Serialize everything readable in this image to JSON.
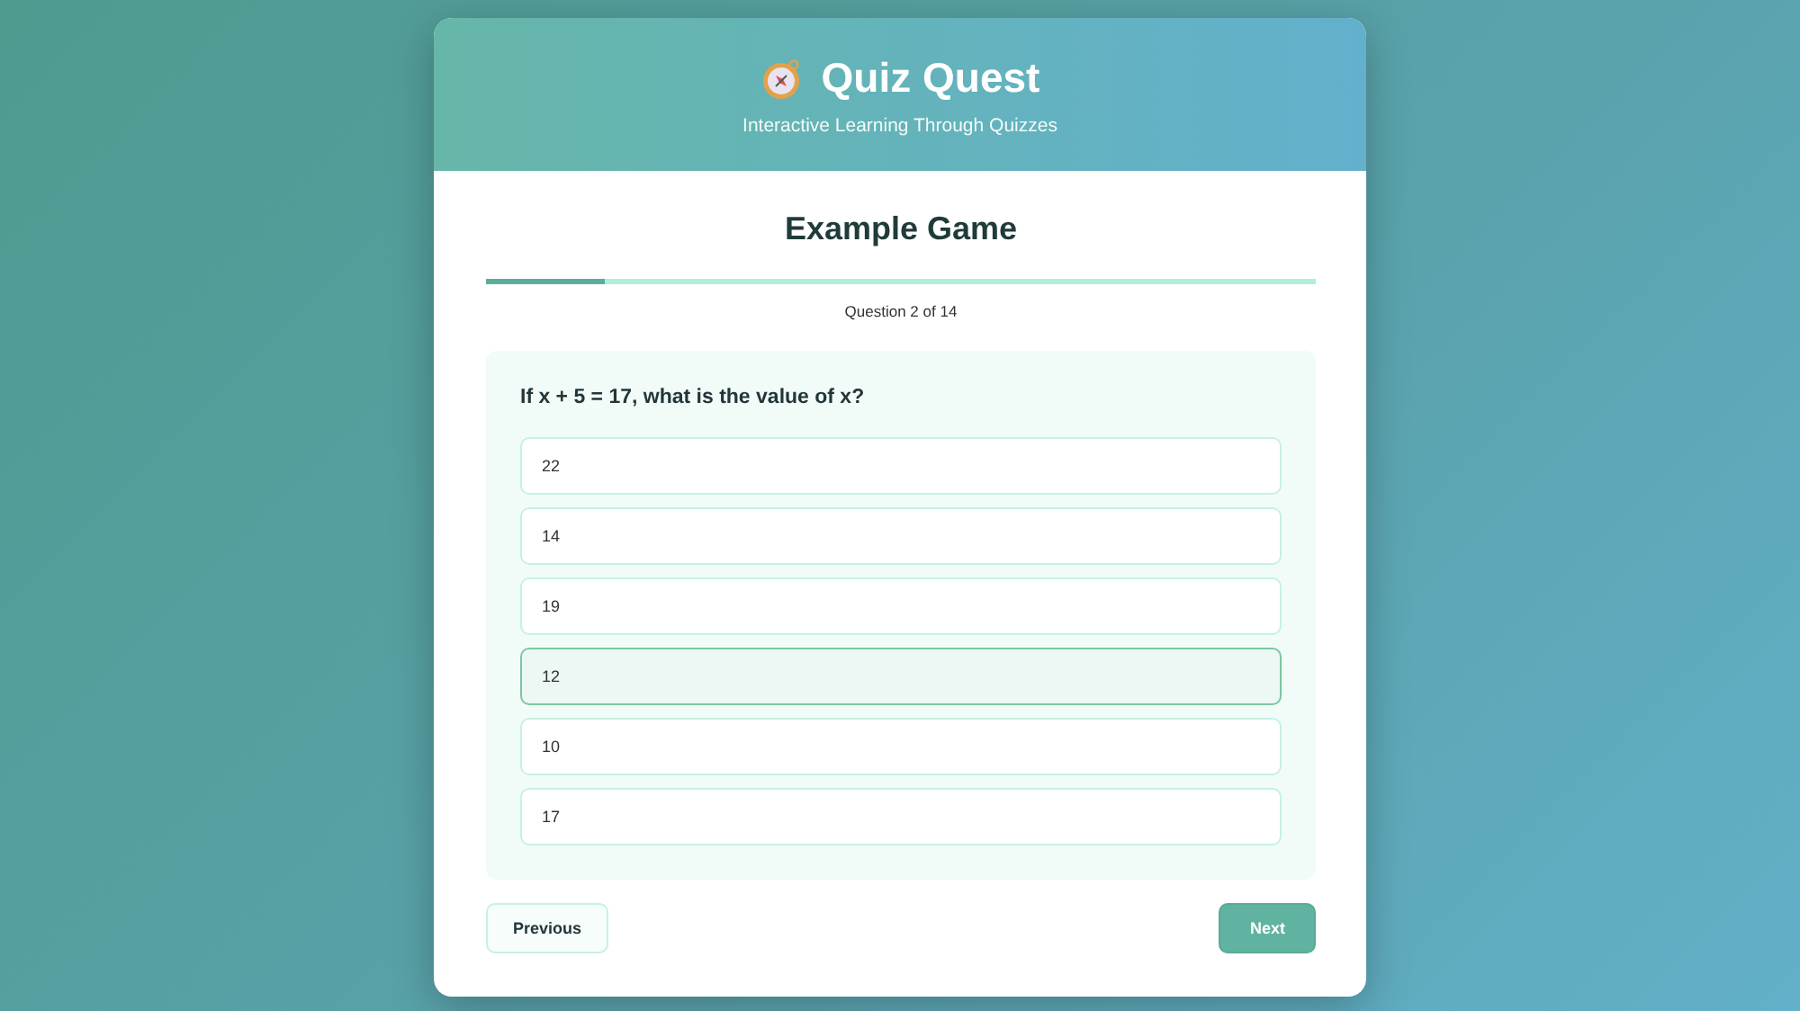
{
  "header": {
    "title": "Quiz Quest",
    "subtitle": "Interactive Learning Through Quizzes"
  },
  "game": {
    "title": "Example Game",
    "progress": {
      "level": 0.143,
      "label": "Question 2 of 14"
    }
  },
  "question": {
    "text": "If x + 5 = 17, what is the value of x?",
    "options": [
      {
        "label": "22",
        "selected": false
      },
      {
        "label": "14",
        "selected": false
      },
      {
        "label": "19",
        "selected": false
      },
      {
        "label": "12",
        "selected": true
      },
      {
        "label": "10",
        "selected": false
      },
      {
        "label": "17",
        "selected": false
      }
    ]
  },
  "buttons": {
    "previous": "Previous",
    "next": "Next"
  }
}
